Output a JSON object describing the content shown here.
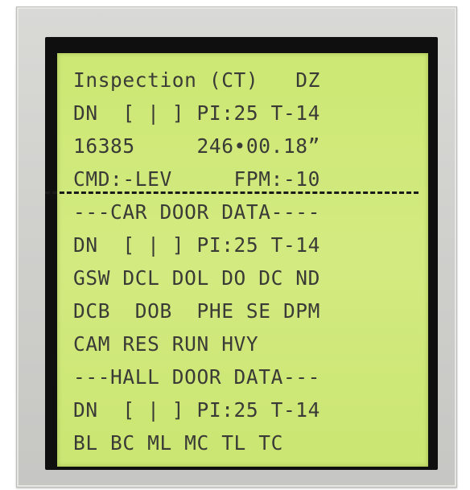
{
  "display": {
    "lines": [
      "Inspection (CT)   DZ",
      "DN  [ | ] PI:25 T-14",
      "16385     246•00.18”",
      "CMD:-LEV     FPM:-10",
      "---CAR DOOR DATA----",
      "DN  [ | ] PI:25 T-14",
      "GSW DCL DOL DO DC ND",
      "DCB  DOB  PHE SE DPM",
      "CAM RES RUN HVY",
      "---HALL DOOR DATA---",
      "DN  [ | ] PI:25 T-14",
      "BL BC ML MC TL TC"
    ]
  },
  "colors": {
    "lcd_background": "#cfe87a",
    "lcd_text": "#3a3a36",
    "frame": "#0f0f0f",
    "bezel": "#d4d4d1",
    "divider": "#1a1a1a"
  }
}
